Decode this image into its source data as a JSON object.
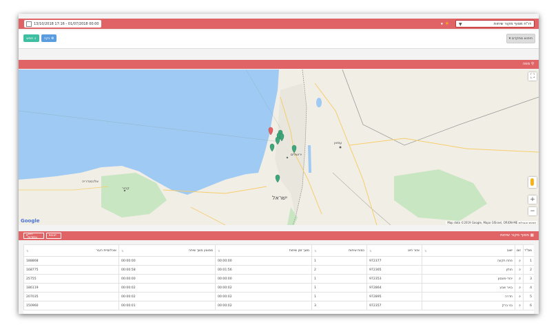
{
  "header": {
    "date_range": "13/10/2018 17:16 - 01/07/2018 00:00",
    "report_select": "דו\"ח מסוף מקור שיחות",
    "star_icon": "star-icon"
  },
  "toolbar": {
    "search_label": "חפש",
    "clear_label": "נקה",
    "advanced_label": "חיפוש מתקדם"
  },
  "map_section": {
    "title": "מפה",
    "label_israel": "ישראל",
    "label_amman": "עמאן",
    "label_jerusalem": "ירושלים",
    "label_alexandria": "אלכסנדריה",
    "label_cairo": "קהיר",
    "google_label": "Google",
    "attribution": "Map data ©2019 Google, Mapa GISrael, ORION-ME   תנאים והגבלות"
  },
  "table_section": {
    "title": "מסוף מקור שיחות",
    "export_label": "ייצוא",
    "columns_label": "הצג עמודות"
  },
  "table": {
    "headers": [
      "מס\"ד",
      "זום",
      "ישוב",
      "אזור חיוג",
      "כמות שיחות",
      "משך זמן שיחות",
      "ממוצע משך שיחה",
      "אוכלוסיית העיר"
    ],
    "rows": [
      [
        "1",
        "פתח תקווה",
        "972377",
        "1",
        "00:00:00",
        "00:00:00",
        "188868"
      ],
      [
        "2",
        "חולון",
        "972365",
        "2",
        "00:01:56",
        "00:00:58",
        "168775"
      ],
      [
        "3",
        "יהוד-מונסון",
        "972353",
        "1",
        "00:00:00",
        "00:00:00",
        "25755"
      ],
      [
        "4",
        "באר שבע",
        "972864",
        "1",
        "00:00:02",
        "00:00:02",
        "186119"
      ],
      [
        "5",
        "חדרה",
        "972895",
        "1",
        "00:00:02",
        "00:00:02",
        "207035"
      ],
      [
        "6",
        "בני ברק",
        "972357",
        "3",
        "00:00:02",
        "00:00:01",
        "150960"
      ]
    ]
  }
}
